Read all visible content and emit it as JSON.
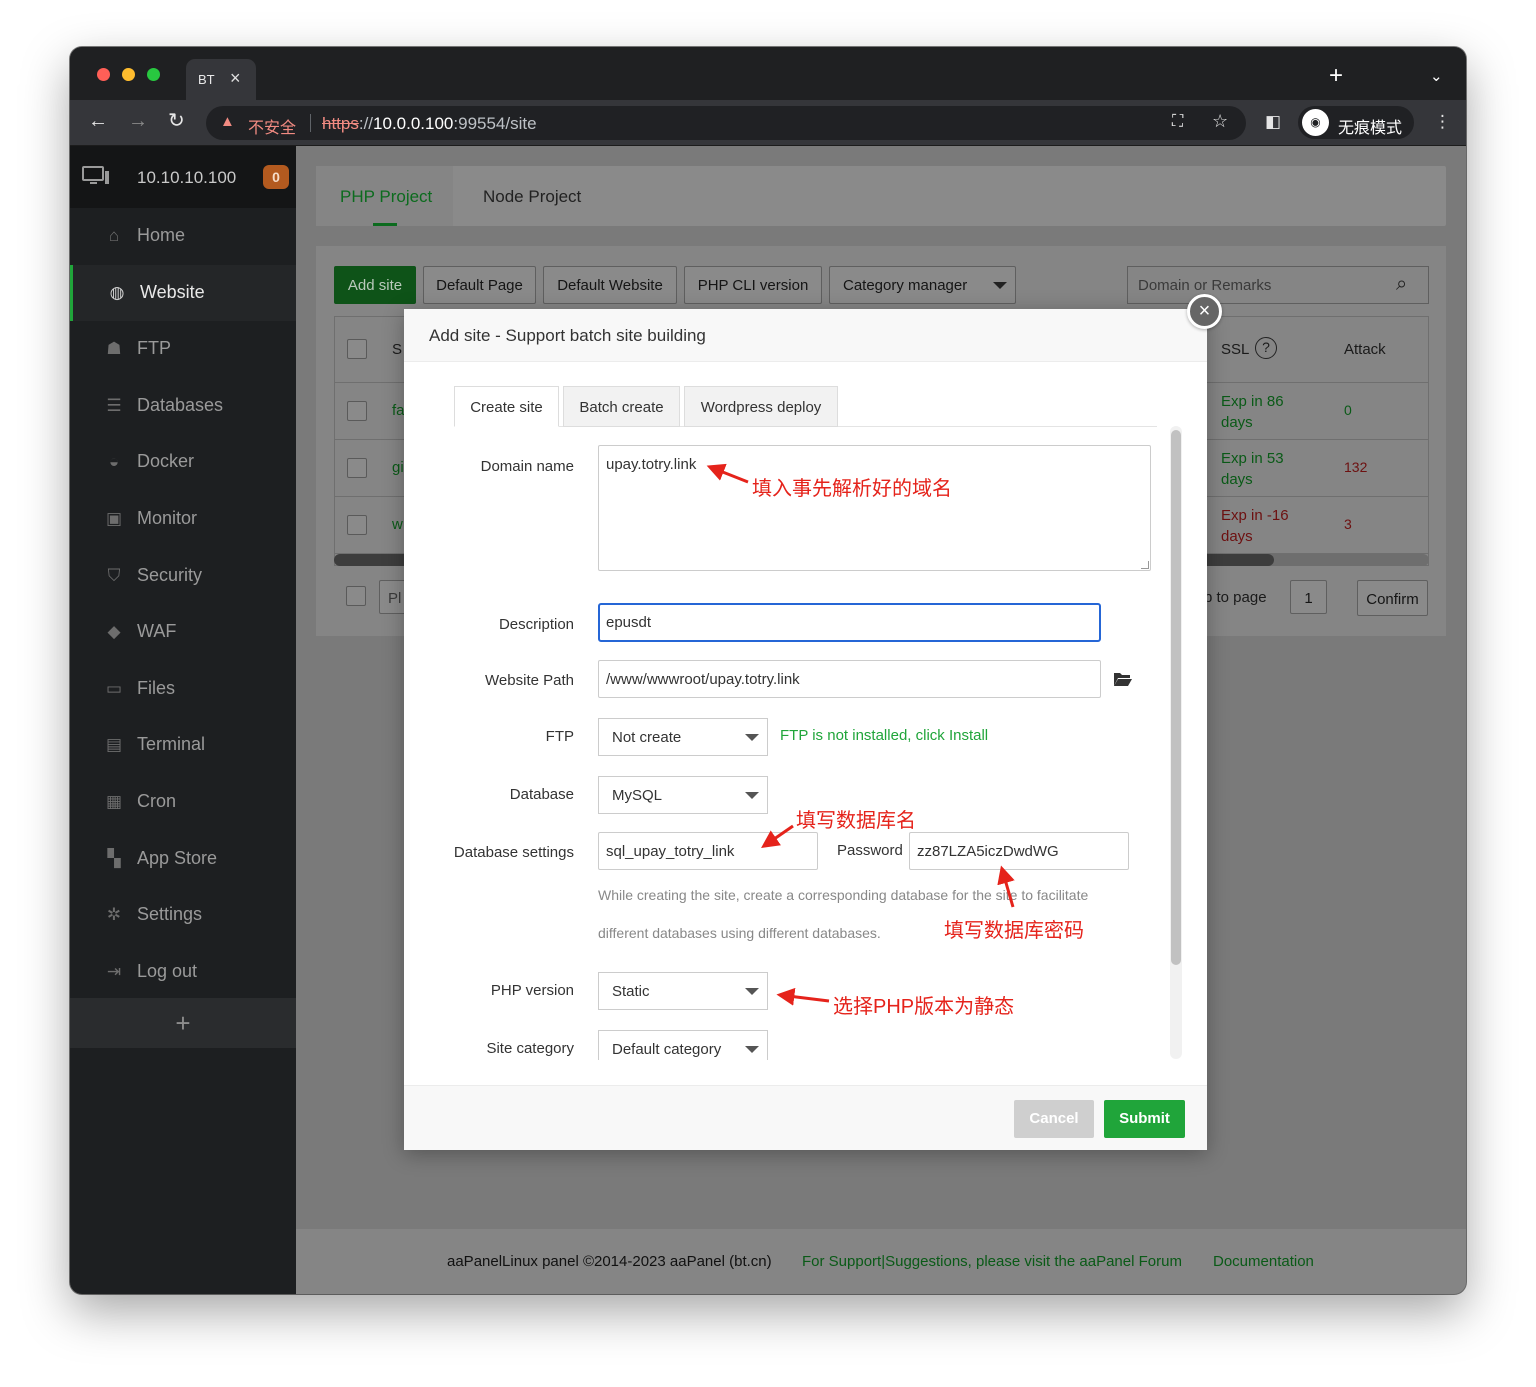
{
  "browser": {
    "tab_title": "BT",
    "insecure_label": "不安全",
    "url_scheme": "https",
    "url_sep": "://",
    "url_host": "10.0.0.100",
    "url_rest": ":99554/site",
    "incognito_label": "无痕模式"
  },
  "sidebar": {
    "ip": "10.10.10.100",
    "badge": "0",
    "items": [
      {
        "label": "Home",
        "icon": "home-icon"
      },
      {
        "label": "Website",
        "icon": "globe-icon"
      },
      {
        "label": "FTP",
        "icon": "ftp-icon"
      },
      {
        "label": "Databases",
        "icon": "database-icon"
      },
      {
        "label": "Docker",
        "icon": "docker-icon"
      },
      {
        "label": "Monitor",
        "icon": "monitor-icon"
      },
      {
        "label": "Security",
        "icon": "shield-icon"
      },
      {
        "label": "WAF",
        "icon": "waf-icon"
      },
      {
        "label": "Files",
        "icon": "folder-icon"
      },
      {
        "label": "Terminal",
        "icon": "terminal-icon"
      },
      {
        "label": "Cron",
        "icon": "calendar-icon"
      },
      {
        "label": "App Store",
        "icon": "apps-icon"
      },
      {
        "label": "Settings",
        "icon": "gear-icon"
      },
      {
        "label": "Log out",
        "icon": "logout-icon"
      }
    ],
    "add_label": "+"
  },
  "project_tabs": [
    "PHP Project",
    "Node Project"
  ],
  "toolbar": {
    "add_site": "Add site",
    "default_page": "Default Page",
    "default_website": "Default Website",
    "php_cli": "PHP CLI version",
    "category_manager": "Category manager",
    "search_placeholder": "Domain or Remarks"
  },
  "table": {
    "headers": {
      "site": "S",
      "ssl": "SSL",
      "attack": "Attack"
    },
    "rows": [
      {
        "site": "fa",
        "ssl": "Exp in 86 days",
        "attack": "0"
      },
      {
        "site": "gi",
        "ssl": "Exp in 53 days",
        "attack": "132"
      },
      {
        "site": "w",
        "ssl": "Exp in -16 days",
        "attack": "3"
      }
    ],
    "batch_placeholder": "Pl",
    "jump_label": "p to page",
    "page_value": "1",
    "confirm": "Confirm"
  },
  "footer": {
    "copyright": "aaPanelLinux panel ©2014-2023 aaPanel (bt.cn)",
    "support": "For Support|Suggestions, please visit the aaPanel Forum",
    "docs": "Documentation"
  },
  "modal": {
    "title": "Add site - Support batch site building",
    "tabs": [
      "Create site",
      "Batch create",
      "Wordpress deploy"
    ],
    "labels": {
      "domain": "Domain name",
      "description": "Description",
      "path": "Website Path",
      "ftp": "FTP",
      "database": "Database",
      "db_settings": "Database settings",
      "password": "Password",
      "php": "PHP version",
      "category": "Site category"
    },
    "values": {
      "domain": "upay.totry.link",
      "description": "epusdt",
      "path": "/www/wwwroot/upay.totry.link",
      "ftp": "Not create",
      "database": "MySQL",
      "db_name": "sql_upay_totry_link",
      "password": "zz87LZA5iczDwdWG",
      "php": "Static",
      "category": "Default category"
    },
    "ftp_hint": "FTP is not installed, click Install",
    "db_hint_1": "While creating the site, create a corresponding database for the site to facilitate",
    "db_hint_2": "different databases using different databases.",
    "cancel": "Cancel",
    "submit": "Submit"
  },
  "annotations": {
    "domain": "填入事先解析好的域名",
    "db_name": "填写数据库名",
    "db_password": "填写数据库密码",
    "php": "选择PHP版本为静态"
  },
  "colors": {
    "accent_green": "#20a53a",
    "annotation_red": "#e5231b",
    "focus_blue": "#2566d6"
  }
}
